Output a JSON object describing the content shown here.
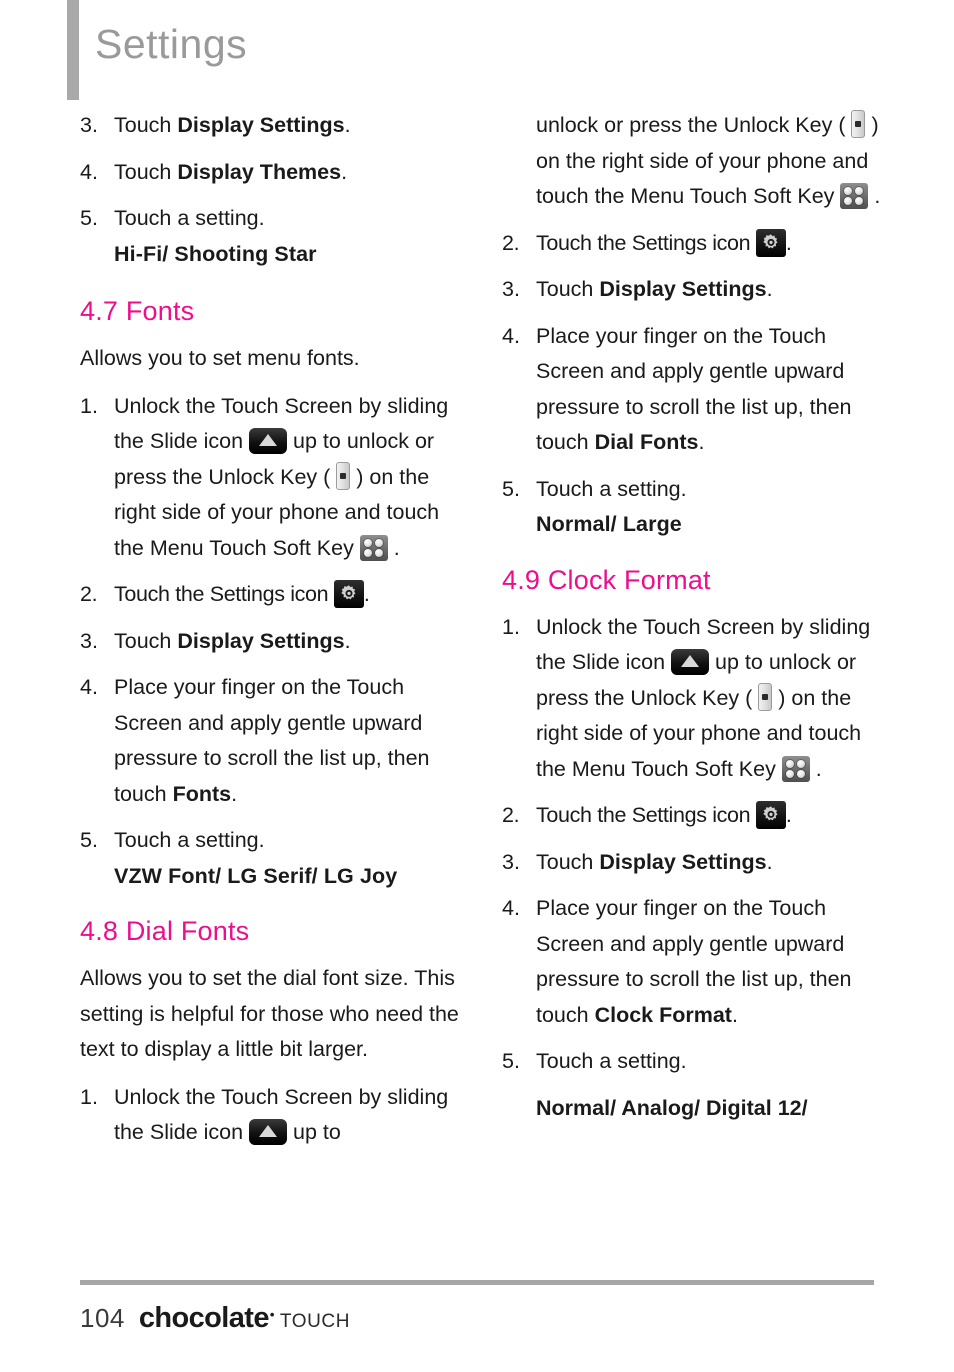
{
  "header": {
    "title": "Settings"
  },
  "colors": {
    "section_heading": "#EC0E8C",
    "header_text": "#9A9A9A",
    "header_bar": "#A9A9A9",
    "rule": "#A6A6A6",
    "body_text": "#1A1A1A"
  },
  "icons": {
    "slide": "slide-icon",
    "unlock_key": "unlock-key-icon",
    "menu_soft_key": "menu-touch-soft-key-icon",
    "settings": "settings-gear-icon"
  },
  "left_column": {
    "step3_num": "3.",
    "step3_pre": "Touch ",
    "step3_bold": "Display Settings",
    "step3_post": ".",
    "step4_num": "4.",
    "step4_pre": "Touch ",
    "step4_bold": "Display Themes",
    "step4_post": ".",
    "step5_num": "5.",
    "step5_text": "Touch a setting.",
    "step5_options": "Hi-Fi/ Shooting Star",
    "section_47": "4.7 Fonts",
    "intro_47": "Allows you to set menu fonts.",
    "f1_num": "1.",
    "f1_a": "Unlock the Touch Screen by sliding the Slide icon ",
    "f1_b": " up to unlock or press the Unlock Key ( ",
    "f1_c": " ) on the right side of your phone and touch the Menu Touch Soft Key ",
    "f1_d": " .",
    "f2_num": "2.",
    "f2_a": "Touch the Settings icon ",
    "f2_b": ".",
    "f3_num": "3.",
    "f3_pre": "Touch ",
    "f3_bold": "Display Settings",
    "f3_post": ".",
    "f4_num": "4.",
    "f4_pre": "Place your finger on the Touch Screen and apply gentle upward pressure to scroll the list up, then touch ",
    "f4_bold": "Fonts",
    "f4_post": ".",
    "f5_num": "5.",
    "f5_text": "Touch a setting.",
    "f5_options": "VZW Font/ LG Serif/ LG Joy",
    "section_48": "4.8 Dial Fonts",
    "intro_48": "Allows you to set the dial font size. This setting is helpful for those who need the text to display a little bit larger.",
    "d1_num": "1.",
    "d1_a": "Unlock the Touch Screen by sliding the Slide icon ",
    "d1_b": " up to"
  },
  "right_column": {
    "d1_cont_a": "unlock or press the Unlock Key ( ",
    "d1_cont_b": " ) on the right side of your phone and touch the Menu Touch Soft Key ",
    "d1_cont_c": " .",
    "d2_num": "2.",
    "d2_a": "Touch the Settings icon ",
    "d2_b": ".",
    "d3_num": "3.",
    "d3_pre": "Touch ",
    "d3_bold": "Display Settings",
    "d3_post": ".",
    "d4_num": "4.",
    "d4_pre": "Place your finger on the Touch Screen and apply gentle upward pressure to scroll the list up, then touch  ",
    "d4_bold": "Dial Fonts",
    "d4_post": ".",
    "d5_num": "5.",
    "d5_text": "Touch a setting.",
    "d5_options": "Normal/ Large",
    "section_49": "4.9 Clock Format",
    "c1_num": "1.",
    "c1_a": "Unlock the Touch Screen by sliding the Slide icon ",
    "c1_b": " up to unlock or press the Unlock Key ( ",
    "c1_c": " ) on the right side of your phone and touch the Menu Touch Soft Key ",
    "c1_d": " .",
    "c2_num": "2.",
    "c2_a": "Touch the Settings icon ",
    "c2_b": ".",
    "c3_num": "3.",
    "c3_pre": "Touch ",
    "c3_bold": "Display Settings",
    "c3_post": ".",
    "c4_num": "4.",
    "c4_pre": "Place your finger on the Touch Screen and apply gentle upward pressure to scroll the list up, then touch ",
    "c4_bold": "Clock Format",
    "c4_post": ".",
    "c5_num": "5.",
    "c5_text": "Touch a setting.",
    "c5_options": "Normal/ Analog/ Digital 12/"
  },
  "footer": {
    "page_number": "104",
    "logo_name": "chocolate",
    "logo_registered": "•",
    "logo_suffix": "TOUCH"
  }
}
